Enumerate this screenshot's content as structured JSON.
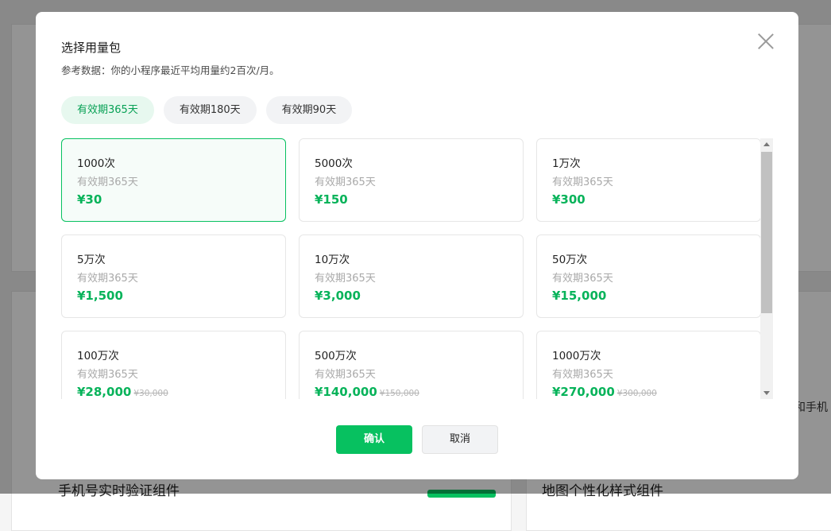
{
  "background": {
    "right_text": "和手机",
    "bottom_left_title": "手机号实时验证组件",
    "bottom_right_title": "地图个性化样式组件"
  },
  "modal": {
    "title": "选择用量包",
    "subtitle": "参考数据：你的小程序最近平均用量约2百次/月。",
    "close_icon": "close-icon",
    "tabs": [
      {
        "label": "有效期365天",
        "active": true
      },
      {
        "label": "有效期180天",
        "active": false
      },
      {
        "label": "有效期90天",
        "active": false
      }
    ],
    "packages": [
      {
        "qty": "1000次",
        "validity": "有效期365天",
        "price": "¥30",
        "original": "",
        "selected": true
      },
      {
        "qty": "5000次",
        "validity": "有效期365天",
        "price": "¥150",
        "original": "",
        "selected": false
      },
      {
        "qty": "1万次",
        "validity": "有效期365天",
        "price": "¥300",
        "original": "",
        "selected": false
      },
      {
        "qty": "5万次",
        "validity": "有效期365天",
        "price": "¥1,500",
        "original": "",
        "selected": false
      },
      {
        "qty": "10万次",
        "validity": "有效期365天",
        "price": "¥3,000",
        "original": "",
        "selected": false
      },
      {
        "qty": "50万次",
        "validity": "有效期365天",
        "price": "¥15,000",
        "original": "",
        "selected": false
      },
      {
        "qty": "100万次",
        "validity": "有效期365天",
        "price": "¥28,000",
        "original": "¥30,000",
        "selected": false
      },
      {
        "qty": "500万次",
        "validity": "有效期365天",
        "price": "¥140,000",
        "original": "¥150,000",
        "selected": false
      },
      {
        "qty": "1000万次",
        "validity": "有效期365天",
        "price": "¥270,000",
        "original": "¥300,000",
        "selected": false
      }
    ],
    "confirm_label": "确认",
    "cancel_label": "取消"
  },
  "colors": {
    "accent": "#07c160",
    "price": "#07b35a",
    "tab_active_bg": "#e7f8ef"
  }
}
